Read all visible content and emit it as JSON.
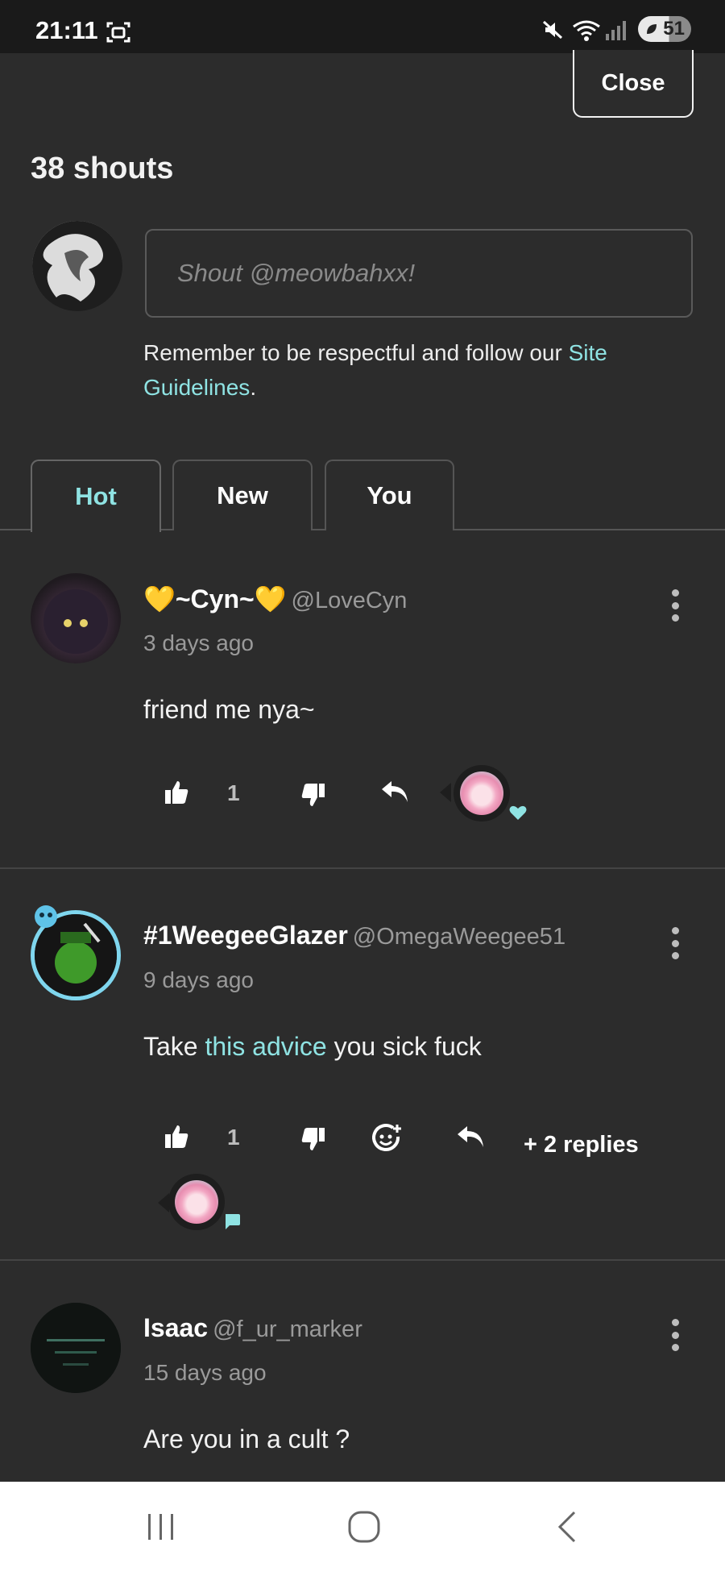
{
  "status_bar": {
    "time": "21:11",
    "battery": "51",
    "icons": [
      "screen-record-icon",
      "mute-icon",
      "wifi-icon",
      "signal-icon",
      "battery-saver-icon"
    ]
  },
  "close_label": "Close",
  "shouts_title": "38 shouts",
  "shout_input": {
    "placeholder": "Shout @meowbahxx!"
  },
  "guidelines": {
    "prefix": "Remember to be respectful and follow our ",
    "link": "Site Guidelines",
    "suffix": "."
  },
  "tabs": [
    {
      "label": "Hot",
      "active": true
    },
    {
      "label": "New",
      "active": false
    },
    {
      "label": "You",
      "active": false
    }
  ],
  "posts": [
    {
      "display_name": "💛~Cyn~💛",
      "handle": "@LoveCyn",
      "time": "3 days ago",
      "body": "friend me nya~",
      "likes": "1",
      "reaction_badge": "heart"
    },
    {
      "display_name": "#1WeegeeGlazer",
      "handle": "@OmegaWeegee51",
      "time": "9 days ago",
      "body_prefix": "Take ",
      "body_link": "this advice",
      "body_suffix": " you sick fuck",
      "likes": "1",
      "replies": "+ 2 replies",
      "reaction_badge": "comment"
    },
    {
      "display_name": "Isaac",
      "handle": "@f_ur_marker",
      "time": "15 days ago",
      "body": "Are you in a cult ?"
    }
  ],
  "colors": {
    "background": "#2c2c2c",
    "accent": "#8fe3e3",
    "muted": "#9a9a9a"
  }
}
